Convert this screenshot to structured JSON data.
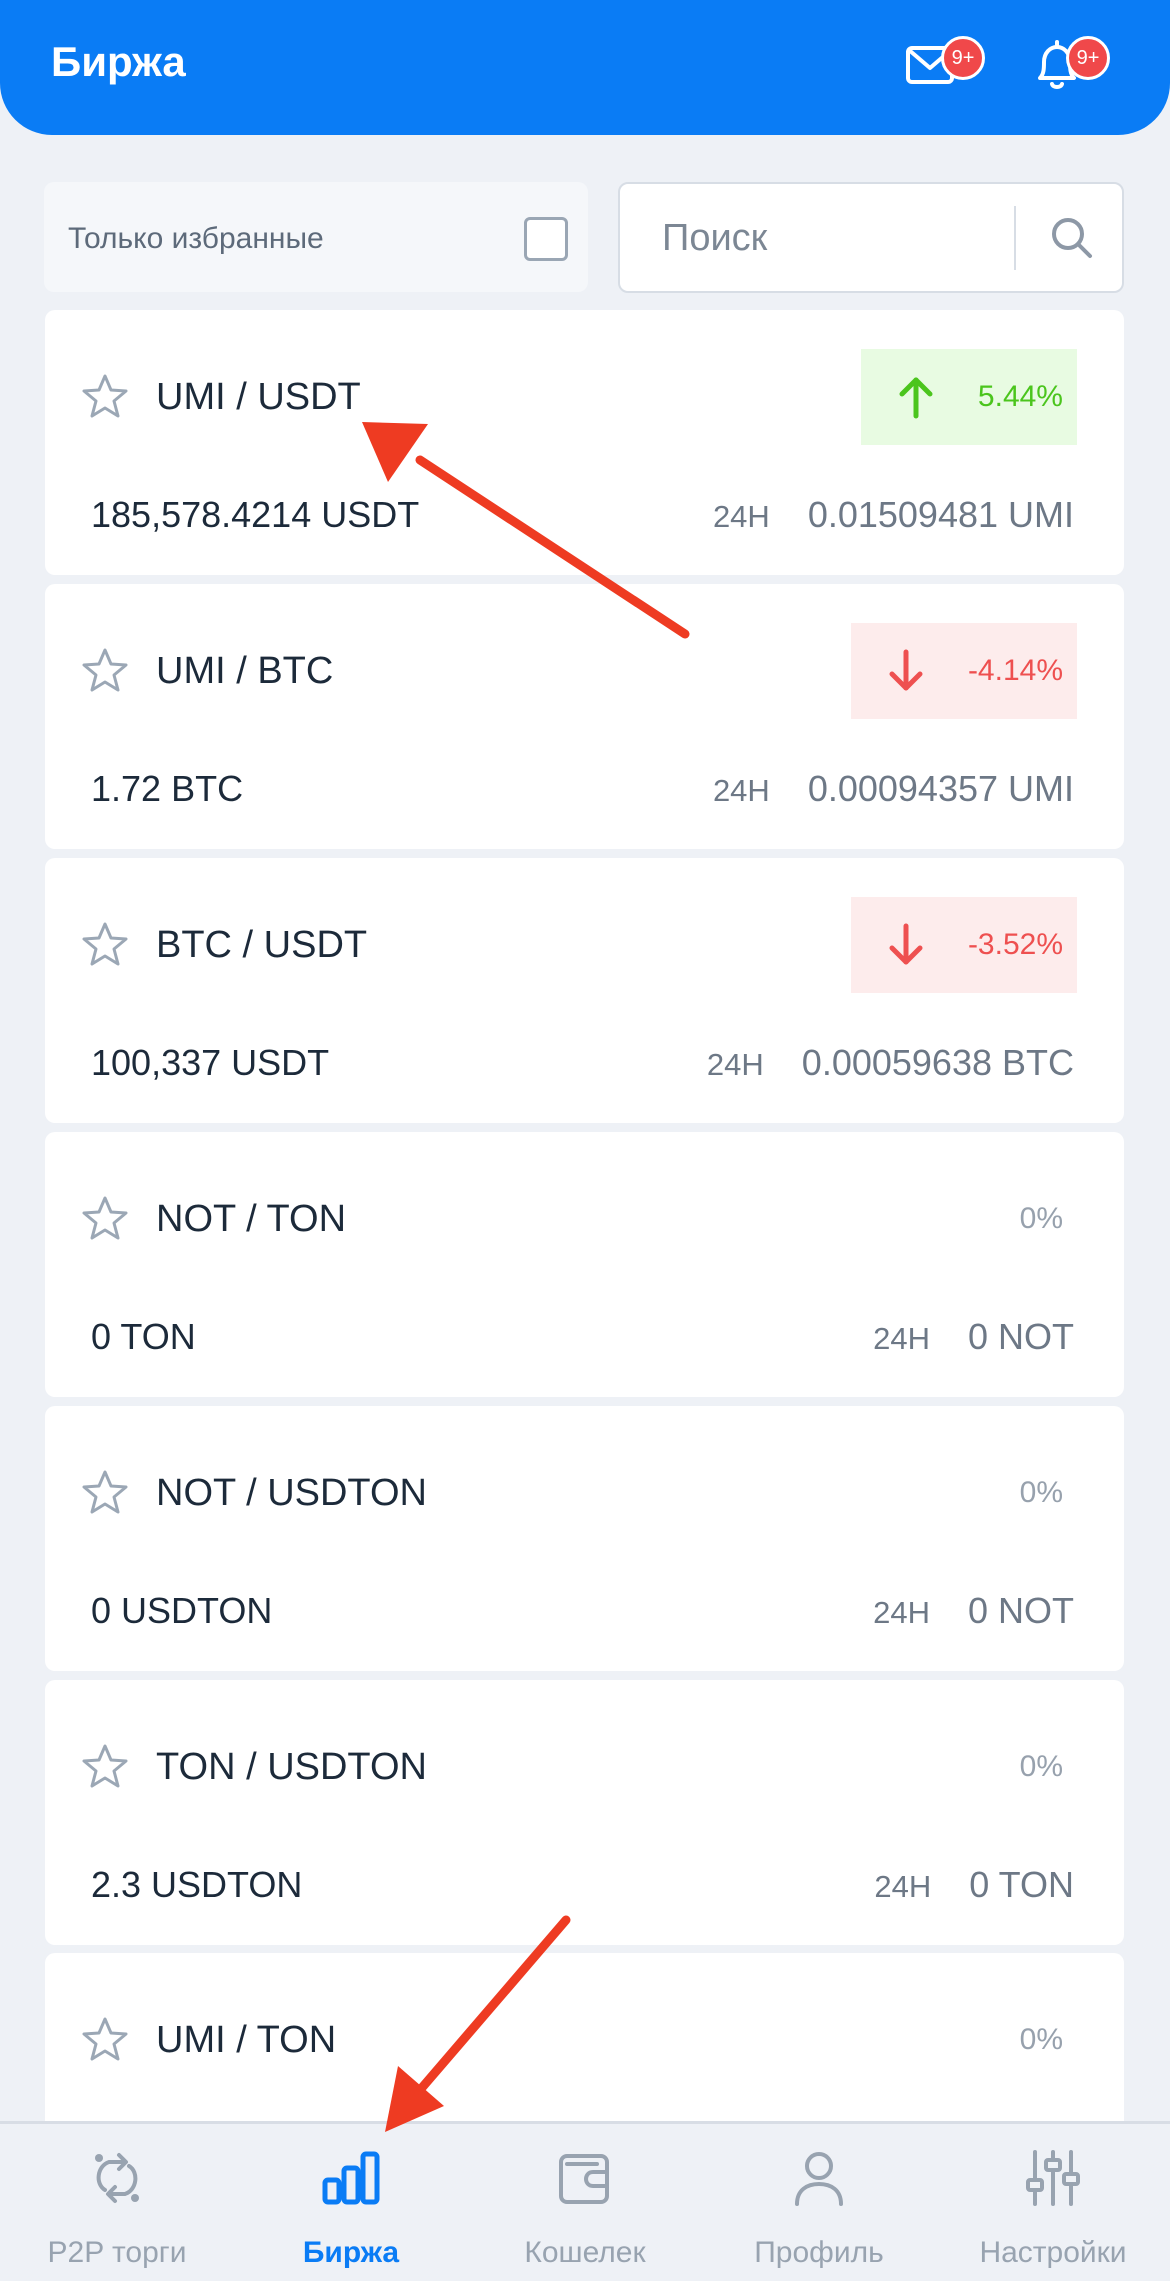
{
  "header": {
    "title": "Биржа",
    "mail_badge": "9+",
    "bell_badge": "9+"
  },
  "filter": {
    "favorites_label": "Только избранные",
    "favorites_checked": false
  },
  "search": {
    "placeholder": "Поиск",
    "value": ""
  },
  "markets": [
    {
      "pair": "UMI / USDT",
      "change": "5.44%",
      "direction": "up",
      "volume": "185,578.4214 USDT",
      "period": "24H",
      "price": "0.01509481 UMI"
    },
    {
      "pair": "UMI / BTC",
      "change": "-4.14%",
      "direction": "down",
      "volume": "1.72 BTC",
      "period": "24H",
      "price": "0.00094357 UMI"
    },
    {
      "pair": "BTC / USDT",
      "change": "-3.52%",
      "direction": "down",
      "volume": "100,337 USDT",
      "period": "24H",
      "price": "0.00059638 BTC"
    },
    {
      "pair": "NOT / TON",
      "change": "0%",
      "direction": "flat",
      "volume": "0 TON",
      "period": "24H",
      "price": "0 NOT"
    },
    {
      "pair": "NOT / USDTON",
      "change": "0%",
      "direction": "flat",
      "volume": "0 USDTON",
      "period": "24H",
      "price": "0 NOT"
    },
    {
      "pair": "TON / USDTON",
      "change": "0%",
      "direction": "flat",
      "volume": "2.3 USDTON",
      "period": "24H",
      "price": "0 TON"
    },
    {
      "pair": "UMI / TON",
      "change": "0%",
      "direction": "flat",
      "volume": "",
      "period": "",
      "price": ""
    }
  ],
  "nav": {
    "items": [
      {
        "label": "P2P торги",
        "icon": "p2p-exchange-icon",
        "active": false
      },
      {
        "label": "Биржа",
        "icon": "bar-chart-icon",
        "active": true
      },
      {
        "label": "Кошелек",
        "icon": "wallet-icon",
        "active": false
      },
      {
        "label": "Профиль",
        "icon": "user-icon",
        "active": false
      },
      {
        "label": "Настройки",
        "icon": "sliders-icon",
        "active": false
      }
    ]
  },
  "colors": {
    "brand": "#0a7cf5",
    "up": "#4bc51d",
    "up_bg": "#e8fbe2",
    "down": "#ee5050",
    "down_bg": "#fdecec",
    "badge": "#f0484a",
    "annotation_arrow": "#ee3b22"
  }
}
